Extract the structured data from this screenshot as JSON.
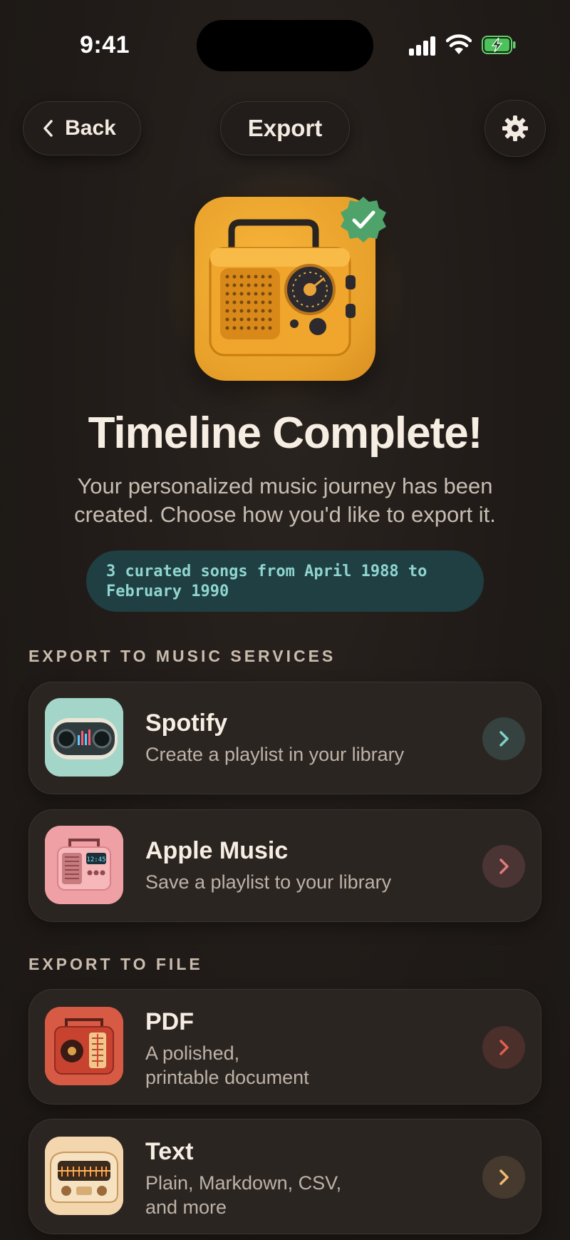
{
  "status_bar": {
    "time": "9:41"
  },
  "nav": {
    "back_label": "Back",
    "title": "Export",
    "settings_icon": "gear-icon"
  },
  "hero": {
    "icon": "retro-radio",
    "badge_icon": "check-badge-icon",
    "colors": {
      "tile": "#e8a12b",
      "badge": "#4fa36a"
    }
  },
  "headline": "Timeline Complete!",
  "subline": "Your personalized music journey has been created. Choose how you'd like to export it.",
  "summary": {
    "line1": "3 curated songs from April 1988 to",
    "line2": "February 1990"
  },
  "sections": {
    "music_services_label": "EXPORT TO MUSIC SERVICES",
    "file_label": "EXPORT TO FILE"
  },
  "options": [
    {
      "title": "Spotify",
      "desc": "Create a playlist in your library",
      "accent": "#7fd0c8",
      "chevron_bg": "#35423f"
    },
    {
      "title": "Apple Music",
      "desc": "Save a playlist to your library",
      "accent": "#e07a7a",
      "chevron_bg": "#4a3434"
    },
    {
      "title": "PDF",
      "desc1": "A polished,",
      "desc2": "printable document",
      "accent": "#e0604e",
      "chevron_bg": "#4a2f2b"
    },
    {
      "title": "Text",
      "desc1": "Plain, Markdown, CSV,",
      "desc2": "and more",
      "accent": "#f0b872",
      "chevron_bg": "#463a2f"
    }
  ]
}
